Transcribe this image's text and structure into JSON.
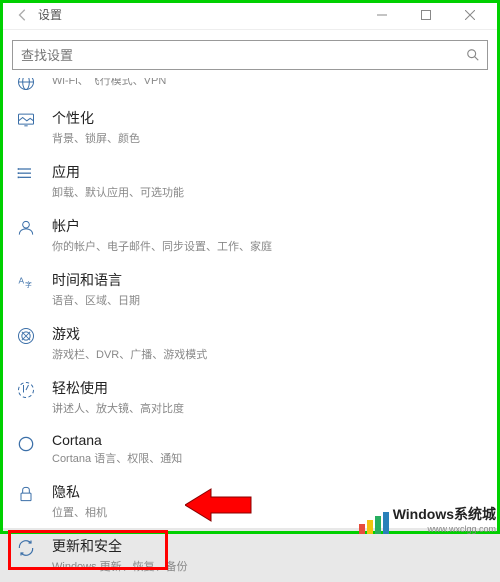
{
  "window": {
    "title": "设置"
  },
  "search": {
    "placeholder": "查找设置"
  },
  "items": {
    "network": {
      "title": "",
      "subtitle": "Wi-Fi、飞行模式、VPN"
    },
    "personalization": {
      "title": "个性化",
      "subtitle": "背景、锁屏、颜色"
    },
    "apps": {
      "title": "应用",
      "subtitle": "卸载、默认应用、可选功能"
    },
    "accounts": {
      "title": "帐户",
      "subtitle": "你的帐户、电子邮件、同步设置、工作、家庭"
    },
    "time": {
      "title": "时间和语言",
      "subtitle": "语音、区域、日期"
    },
    "gaming": {
      "title": "游戏",
      "subtitle": "游戏栏、DVR、广播、游戏模式"
    },
    "ease": {
      "title": "轻松使用",
      "subtitle": "讲述人、放大镜、高对比度"
    },
    "cortana": {
      "title": "Cortana",
      "subtitle": "Cortana 语言、权限、通知"
    },
    "privacy": {
      "title": "隐私",
      "subtitle": "位置、相机"
    },
    "update": {
      "title": "更新和安全",
      "subtitle": "Windows 更新、恢复、备份"
    }
  },
  "watermark": {
    "title": "Windows系统城",
    "url": "www.wxclgg.com"
  }
}
